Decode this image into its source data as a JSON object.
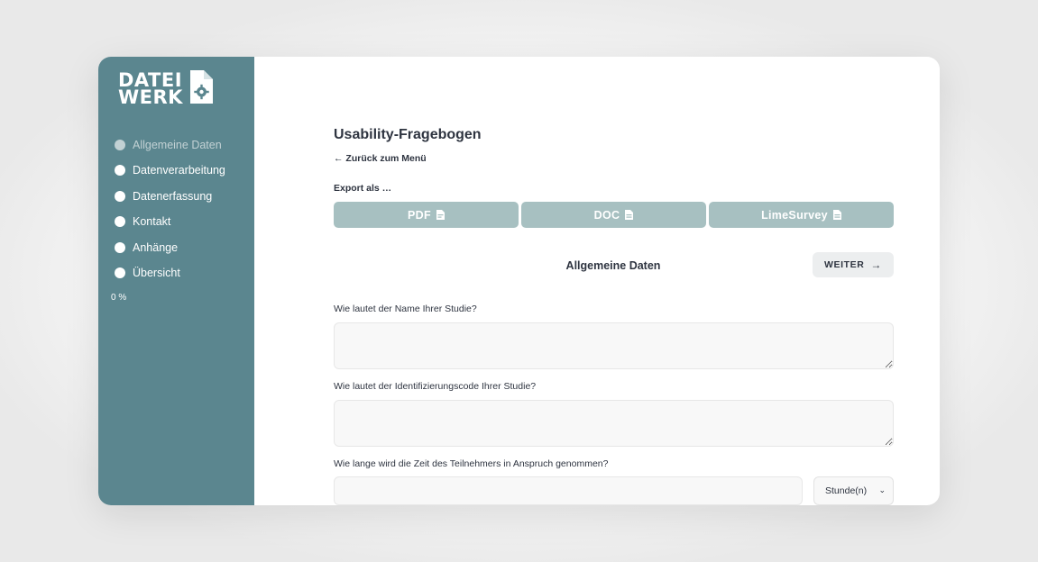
{
  "brand": {
    "logo_line1": "DATEI",
    "logo_line2": "WERK",
    "accent_color": "#5b868f",
    "button_color": "#a7c0c1"
  },
  "sidebar": {
    "items": [
      {
        "label": "Allgemeine Daten",
        "active": true
      },
      {
        "label": "Datenverarbeitung",
        "active": false
      },
      {
        "label": "Datenerfassung",
        "active": false
      },
      {
        "label": "Kontakt",
        "active": false
      },
      {
        "label": "Anhänge",
        "active": false
      },
      {
        "label": "Übersicht",
        "active": false
      }
    ],
    "progress": "0 %"
  },
  "page": {
    "title": "Usability-Fragebogen",
    "back_link": "← Zurück zum Menü",
    "export_label": "Export als …",
    "export_buttons": [
      {
        "label": "PDF",
        "icon": "pdf-file-icon"
      },
      {
        "label": "DOC",
        "icon": "doc-file-icon"
      },
      {
        "label": "LimeSurvey",
        "icon": "file-icon"
      }
    ]
  },
  "section": {
    "title": "Allgemeine Daten",
    "next_label": "WEITER",
    "next_icon": "arrow-right-icon"
  },
  "questions": [
    {
      "label": "Wie lautet der Name Ihrer Studie?",
      "value": ""
    },
    {
      "label": "Wie lautet der Identifizierungscode Ihrer Studie?",
      "value": ""
    },
    {
      "label": "Wie lange wird die Zeit des Teilnehmers in Anspruch genommen?",
      "value": "",
      "unit": "Stunde(n)"
    }
  ]
}
